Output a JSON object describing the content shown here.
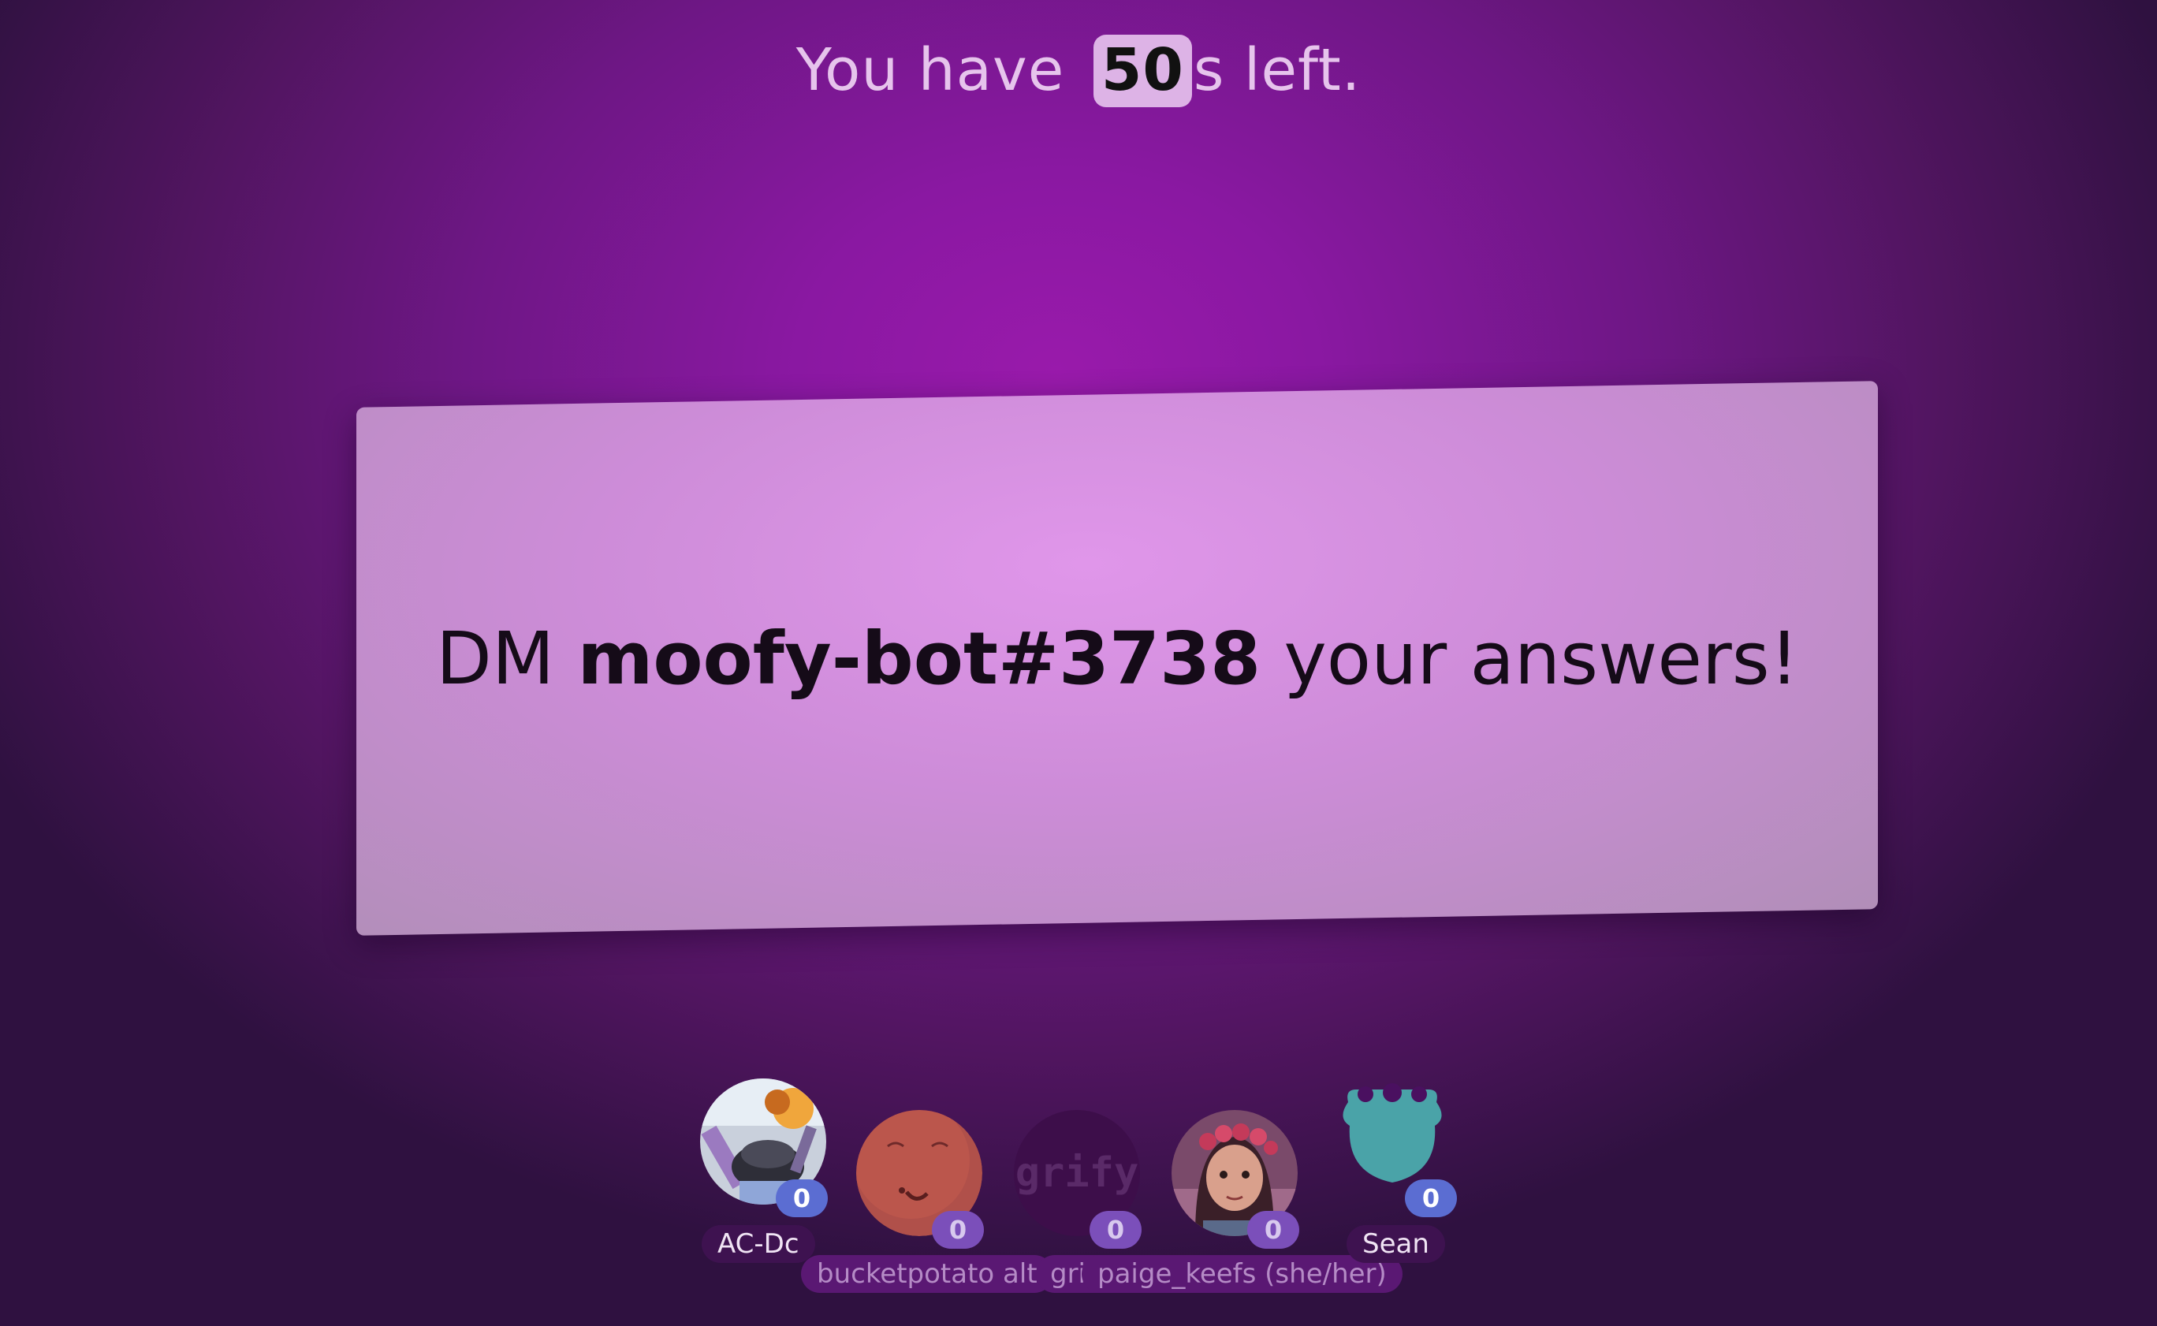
{
  "timer": {
    "prefix": "You have",
    "seconds": "50",
    "suffix": "s left."
  },
  "prompt": {
    "before": "DM",
    "bot_name": "moofy-bot#3738",
    "after": "your answers!"
  },
  "players": [
    {
      "name": "AC-Dc",
      "score": "0",
      "avatar_icon": "robot-avatar-icon"
    },
    {
      "name": "bucketpotato alt",
      "score": "0",
      "avatar_icon": "potato-face-avatar-icon"
    },
    {
      "name": "grify",
      "score": "0",
      "avatar_icon": "grify-logo-avatar-icon",
      "avatar_text": "grify"
    },
    {
      "name": "paige_keefs (she/her)",
      "score": "0",
      "avatar_icon": "flower-crown-girl-avatar-icon"
    },
    {
      "name": "Sean",
      "score": "0",
      "avatar_icon": "teal-creature-avatar-icon"
    }
  ],
  "colors": {
    "card": "#cd8cd8",
    "score_badge": "#5b6dd2",
    "background": "#8a18a2"
  }
}
